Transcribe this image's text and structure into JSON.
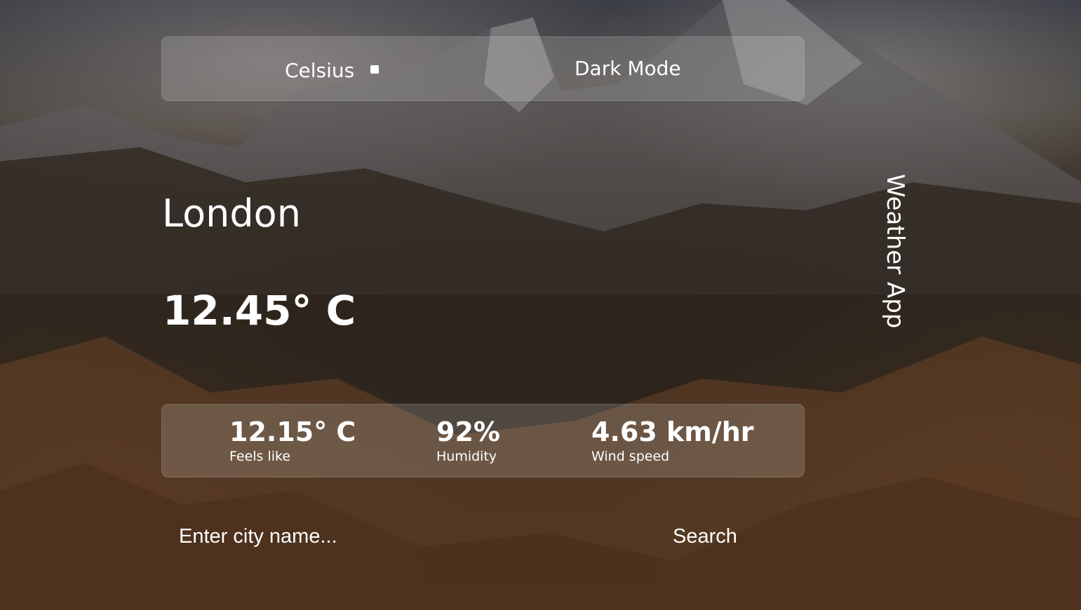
{
  "header": {
    "unit_label": "Celsius",
    "mode_label": "Dark Mode"
  },
  "weather": {
    "city": "London",
    "temperature": "12.45° C"
  },
  "app": {
    "title": "Weather App"
  },
  "stats": {
    "feels_like": {
      "value": "12.15° C",
      "label": "Feels like"
    },
    "humidity": {
      "value": "92%",
      "label": "Humidity"
    },
    "wind_speed": {
      "value": "4.63 km/hr",
      "label": "Wind speed"
    }
  },
  "search": {
    "placeholder": "Enter city name...",
    "value": "",
    "button_label": "Search"
  },
  "colors": {
    "text": "#ffffff",
    "panel": "rgba(255,255,255,0.16)"
  }
}
